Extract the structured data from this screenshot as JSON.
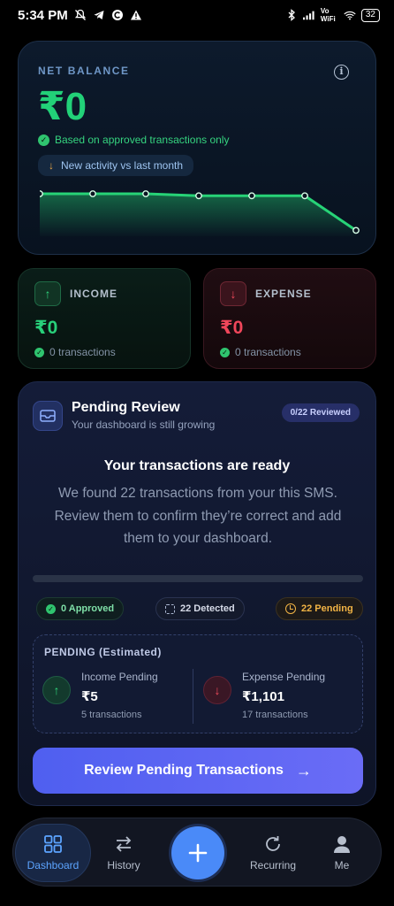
{
  "status_bar": {
    "time": "5:34 PM",
    "left_icons": [
      "mute-bell-icon",
      "telegram-icon",
      "c-app-icon",
      "warning-icon"
    ],
    "vowifi": "Vo WiFi",
    "battery": "32"
  },
  "net_balance": {
    "label": "NET BALANCE",
    "amount": "₹0",
    "approved_note": "Based on approved transactions only",
    "activity_label": "New activity vs last month",
    "sparkline": [
      1.0,
      1.0,
      1.0,
      0.95,
      0.95,
      0.95,
      0.1
    ]
  },
  "income": {
    "label": "INCOME",
    "amount": "₹0",
    "count": "0 transactions"
  },
  "expense": {
    "label": "EXPENSE",
    "amount": "₹0",
    "count": "0 transactions"
  },
  "pending_review": {
    "title": "Pending Review",
    "subtitle": "Your dashboard is still growing",
    "reviewed_badge": "0/22 Reviewed",
    "heading": "Your transactions are ready",
    "description": "We found 22 transactions from your this SMS. Review them to confirm they’re correct and add them to your dashboard.",
    "progress": 0,
    "chips": {
      "approved": "0 Approved",
      "detected": "22 Detected",
      "pending": "22 Pending"
    },
    "estimated": {
      "title": "PENDING (Estimated)",
      "income_label": "Income Pending",
      "income_amount": "₹5",
      "income_count": "5 transactions",
      "expense_label": "Expense Pending",
      "expense_amount": "₹1,101",
      "expense_count": "17 transactions"
    },
    "cta_label": "Review Pending Transactions"
  },
  "bottom_nav": {
    "dashboard": "Dashboard",
    "history": "History",
    "recurring": "Recurring",
    "me": "Me"
  },
  "colors": {
    "accent": "#4a8af8",
    "income": "#28d07a",
    "expense": "#f0465a",
    "pending": "#f2b445"
  }
}
